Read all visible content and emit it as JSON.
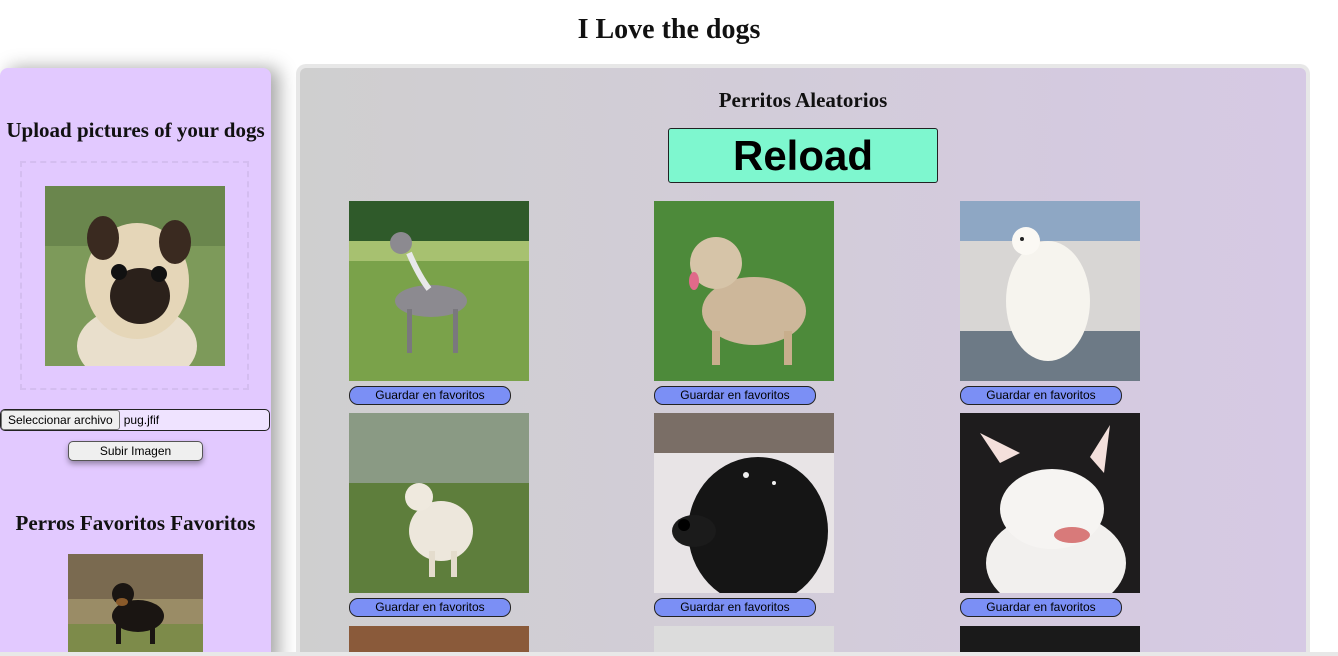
{
  "page": {
    "title": "I Love the dogs"
  },
  "sidebar": {
    "upload_title": "Upload pictures of your dogs",
    "file_button_label": "Seleccionar archivo",
    "file_name": "pug.jfif",
    "upload_button_label": "Subir Imagen",
    "favorites_title": "Perros Favoritos Favoritos"
  },
  "main": {
    "title": "Perritos Aleatorios",
    "reload_label": "Reload",
    "save_label": "Guardar en favoritos"
  },
  "colors": {
    "sidebar_bg": "#e2c9ff",
    "reload_bg": "#7ef7cf",
    "save_button_bg": "#7b8ff5"
  }
}
